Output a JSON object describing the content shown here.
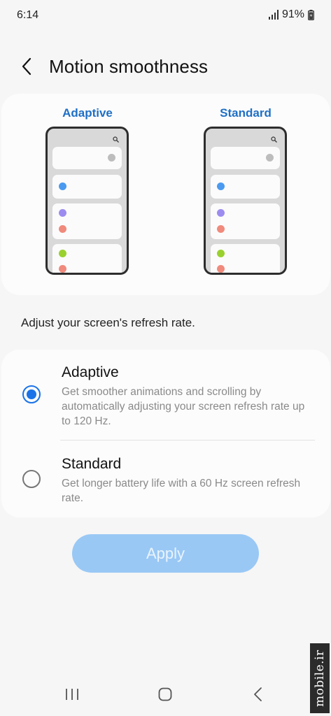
{
  "status_bar": {
    "time": "6:14",
    "battery": "91%"
  },
  "header": {
    "title": "Motion smoothness"
  },
  "preview": {
    "left_label": "Adaptive",
    "right_label": "Standard"
  },
  "subtitle": "Adjust your screen's refresh rate.",
  "options": [
    {
      "title": "Adaptive",
      "description": "Get smoother animations and scrolling by automatically adjusting your screen refresh rate up to 120 Hz.",
      "selected": true
    },
    {
      "title": "Standard",
      "description": "Get longer battery life with a 60 Hz screen refresh rate.",
      "selected": false
    }
  ],
  "apply_label": "Apply",
  "watermark": "mobile.ir",
  "colors": {
    "accent": "#1a73e8",
    "preview_label": "#1f6fc5",
    "apply_button": "#99c8f5",
    "dot_blue": "#4a9af0",
    "dot_purple": "#9d8cf0",
    "dot_salmon": "#f08a7c",
    "dot_green": "#9ad12f",
    "dot_gray": "#bdbdbd"
  }
}
